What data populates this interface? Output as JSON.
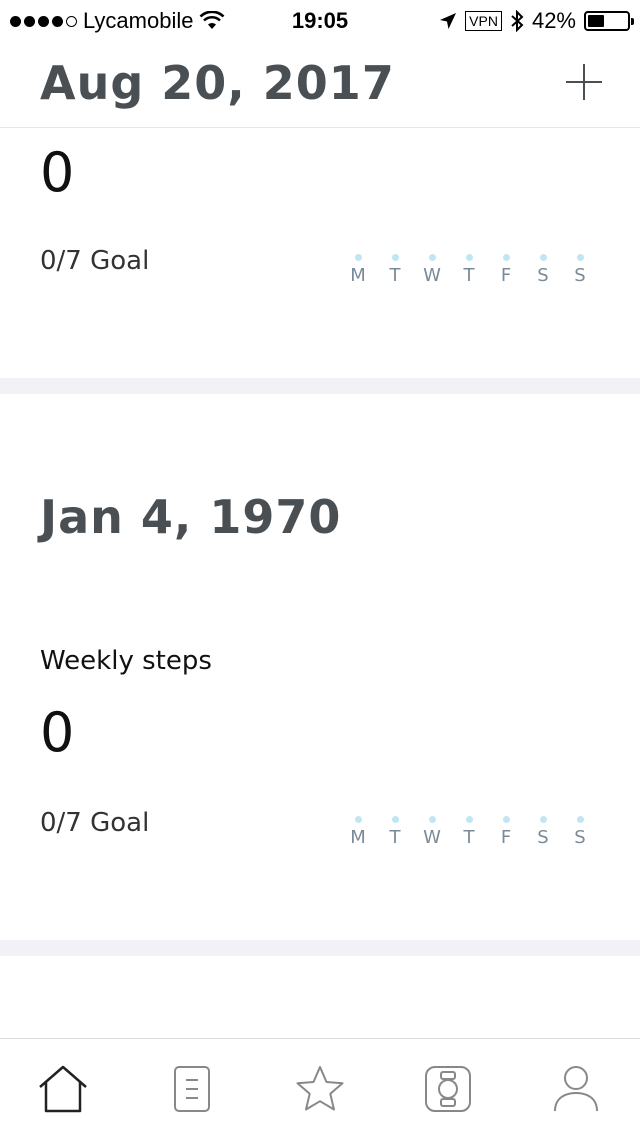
{
  "status_bar": {
    "carrier": "Lycamobile",
    "time": "19:05",
    "vpn": "VPN",
    "battery_text": "42%",
    "battery_level": 0.42
  },
  "header": {
    "date": "Aug 20, 2017"
  },
  "cards": [
    {
      "steps_count": "0",
      "goal_text": "0/7 Goal",
      "days": [
        "M",
        "T",
        "W",
        "T",
        "F",
        "S",
        "S"
      ]
    },
    {
      "date": "Jan 4, 1970",
      "label": "Weekly steps",
      "steps_count": "0",
      "goal_text": "0/7 Goal",
      "days": [
        "M",
        "T",
        "W",
        "T",
        "F",
        "S",
        "S"
      ]
    }
  ],
  "tabs": [
    {
      "icon": "home-icon"
    },
    {
      "icon": "journal-icon"
    },
    {
      "icon": "star-icon"
    },
    {
      "icon": "watch-icon"
    },
    {
      "icon": "profile-icon"
    }
  ],
  "colors": {
    "accent_dot": "#bfe6f2",
    "text_dark": "#4a4f54",
    "separator": "#f2f2f6"
  }
}
